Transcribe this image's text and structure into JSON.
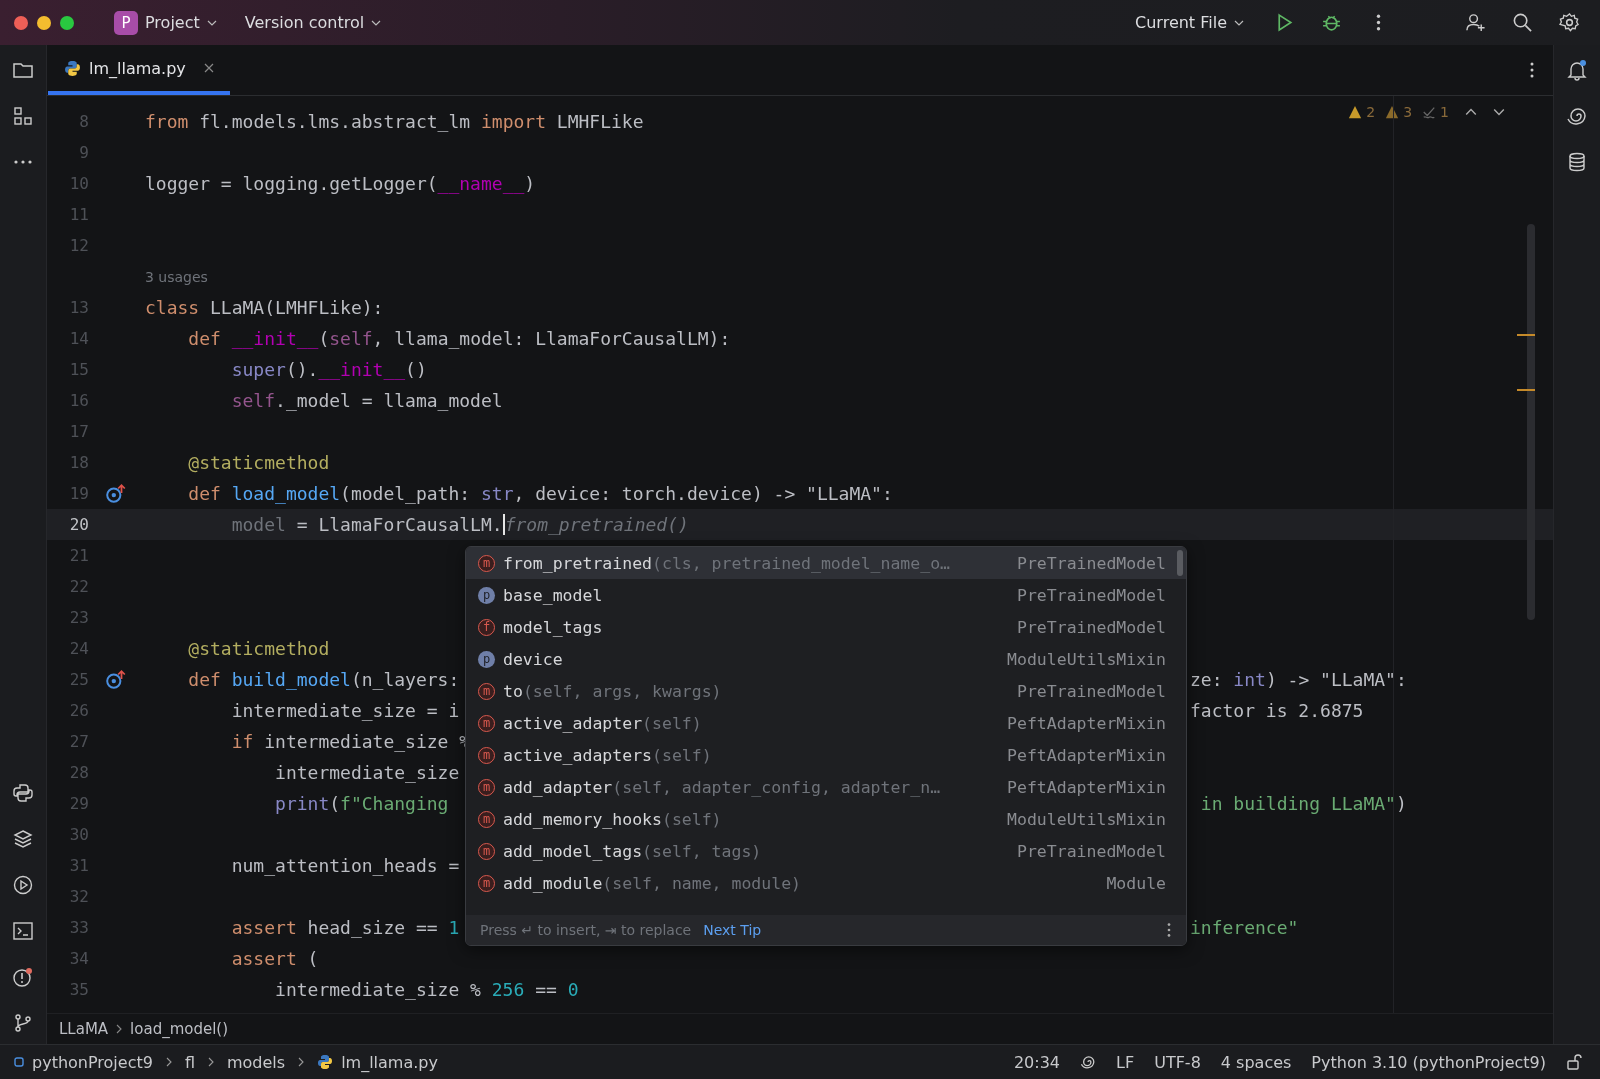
{
  "titlebar": {
    "project_badge": "P",
    "project": "Project",
    "vcs": "Version control",
    "run_config": "Current File"
  },
  "tab": {
    "label": "lm_llama.py",
    "selected": true
  },
  "inspections": {
    "warnings": "2",
    "weak_warnings": "3",
    "typos": "1"
  },
  "rows": [
    {
      "kind": "code",
      "number": "8",
      "tokens": [
        {
          "kind": "kw",
          "s": "from"
        },
        {
          "kind": "plain",
          "s": " fl.models.lms.abstract_lm "
        },
        {
          "kind": "kw",
          "s": "import"
        },
        {
          "kind": "plain",
          "s": " LMHFLike"
        }
      ]
    },
    {
      "kind": "code",
      "number": "9",
      "tokens": []
    },
    {
      "kind": "code",
      "number": "10",
      "tokens": [
        {
          "kind": "plain",
          "s": "logger = logging.getLogger("
        },
        {
          "kind": "dunder",
          "s": "__name__"
        },
        {
          "kind": "plain",
          "s": ")"
        }
      ]
    },
    {
      "kind": "code",
      "number": "11",
      "tokens": []
    },
    {
      "kind": "code",
      "number": "12",
      "tokens": []
    },
    {
      "kind": "usages",
      "text": "3 usages"
    },
    {
      "kind": "code",
      "number": "13",
      "tokens": [
        {
          "kind": "kw",
          "s": "class"
        },
        {
          "kind": "plain",
          "s": " LLaMA(LMHFLike):"
        }
      ]
    },
    {
      "kind": "code",
      "number": "14",
      "tokens": [
        {
          "kind": "kw",
          "s": "    def"
        },
        {
          "kind": "dunder",
          "s": " __init__"
        },
        {
          "kind": "plain",
          "s": "("
        },
        {
          "kind": "self",
          "s": "self"
        },
        {
          "kind": "plain",
          "s": ", llama_model: LlamaForCausalLM):"
        }
      ]
    },
    {
      "kind": "code",
      "number": "15",
      "tokens": [
        {
          "kind": "builtin",
          "s": "        super"
        },
        {
          "kind": "plain",
          "s": "()."
        },
        {
          "kind": "dunder",
          "s": "__init__"
        },
        {
          "kind": "plain",
          "s": "()"
        }
      ]
    },
    {
      "kind": "code",
      "number": "16",
      "tokens": [
        {
          "kind": "self",
          "s": "        self"
        },
        {
          "kind": "plain",
          "s": "._model = llama_model"
        }
      ]
    },
    {
      "kind": "code",
      "number": "17",
      "tokens": []
    },
    {
      "kind": "code",
      "number": "18",
      "tokens": [
        {
          "kind": "deco",
          "s": "    @staticmethod"
        }
      ]
    },
    {
      "kind": "code",
      "number": "19",
      "override": true,
      "tokens": [
        {
          "kind": "kw",
          "s": "    def"
        },
        {
          "kind": "fn",
          "s": " load_model"
        },
        {
          "kind": "plain",
          "s": "(model_path: "
        },
        {
          "kind": "builtin",
          "s": "str"
        },
        {
          "kind": "plain",
          "s": ", device: torch.device) -> \"LLaMA\":"
        }
      ]
    },
    {
      "kind": "code",
      "number": "20",
      "current": true,
      "tokens": [
        {
          "kind": "dim",
          "s": "        model"
        },
        {
          "kind": "plain",
          "s": " = LlamaForCausalLM."
        },
        {
          "kind": "hint",
          "s": "from_pretrained()"
        }
      ]
    },
    {
      "kind": "code",
      "number": "21",
      "tokens": []
    },
    {
      "kind": "code",
      "number": "22",
      "tokens": []
    },
    {
      "kind": "code",
      "number": "23",
      "tokens": []
    },
    {
      "kind": "code",
      "number": "24",
      "tokens": [
        {
          "kind": "deco",
          "s": "    @staticmethod"
        }
      ]
    },
    {
      "kind": "code",
      "number": "25",
      "override": true,
      "tokens": [
        {
          "kind": "kw",
          "s": "    def"
        },
        {
          "kind": "fn",
          "s": " build_model"
        },
        {
          "kind": "plain",
          "s": "(n_layers:"
        }
      ],
      "tail": [
        {
          "kind": "plain",
          "s": "ze: "
        },
        {
          "kind": "builtin",
          "s": "int"
        },
        {
          "kind": "plain",
          "s": ") -> \"LLaMA\":"
        }
      ]
    },
    {
      "kind": "code",
      "number": "26",
      "tokens": [
        {
          "kind": "plain",
          "s": "        intermediate_size = i"
        }
      ],
      "tail": [
        {
          "kind": "plain",
          "s": "factor is 2.6875"
        }
      ]
    },
    {
      "kind": "code",
      "number": "27",
      "tokens": [
        {
          "kind": "kw",
          "s": "        if"
        },
        {
          "kind": "plain",
          "s": " intermediate_size %"
        }
      ]
    },
    {
      "kind": "code",
      "number": "28",
      "tokens": [
        {
          "kind": "plain",
          "s": "            intermediate_size"
        }
      ]
    },
    {
      "kind": "code",
      "number": "29",
      "tokens": [
        {
          "kind": "builtin",
          "s": "            print"
        },
        {
          "kind": "plain",
          "s": "("
        },
        {
          "kind": "str",
          "s": "f\"Changing"
        }
      ],
      "tail": [
        {
          "kind": "str",
          "s": " in building LLaMA\""
        },
        {
          "kind": "plain",
          "s": ")"
        }
      ]
    },
    {
      "kind": "code",
      "number": "30",
      "tokens": []
    },
    {
      "kind": "code",
      "number": "31",
      "tokens": [
        {
          "kind": "plain",
          "s": "        num_attention_heads ="
        }
      ]
    },
    {
      "kind": "code",
      "number": "32",
      "tokens": []
    },
    {
      "kind": "code",
      "number": "33",
      "tokens": [
        {
          "kind": "kw",
          "s": "        assert"
        },
        {
          "kind": "plain",
          "s": " head_size == "
        },
        {
          "kind": "num",
          "s": "1"
        }
      ],
      "tail": [
        {
          "kind": "str",
          "s": "inference\""
        }
      ]
    },
    {
      "kind": "code",
      "number": "34",
      "tokens": [
        {
          "kind": "kw",
          "s": "        assert"
        },
        {
          "kind": "plain",
          "s": " ("
        }
      ]
    },
    {
      "kind": "code",
      "number": "35",
      "tokens": [
        {
          "kind": "plain",
          "s": "            intermediate_size % "
        },
        {
          "kind": "num",
          "s": "256"
        },
        {
          "kind": "plain",
          "s": " == "
        },
        {
          "kind": "num",
          "s": "0"
        }
      ]
    }
  ],
  "completion": {
    "items": [
      {
        "kind": "method",
        "letter": "m",
        "name": "from_pretrained",
        "params": "(cls, pretrained_model_name_o…",
        "type": "PreTrainedModel",
        "selected": true
      },
      {
        "kind": "property",
        "letter": "p",
        "name": "base_model",
        "type": "PreTrainedModel",
        "selected": false
      },
      {
        "kind": "field",
        "letter": "f",
        "name": "model_tags",
        "type": "PreTrainedModel",
        "selected": false
      },
      {
        "kind": "property",
        "letter": "p",
        "name": "device",
        "type": "ModuleUtilsMixin",
        "selected": false
      },
      {
        "kind": "method",
        "letter": "m",
        "name": "to",
        "params": "(self, args, kwargs)",
        "type": "PreTrainedModel",
        "selected": false
      },
      {
        "kind": "method",
        "letter": "m",
        "name": "active_adapter",
        "params": "(self)",
        "type": "PeftAdapterMixin",
        "selected": false
      },
      {
        "kind": "method",
        "letter": "m",
        "name": "active_adapters",
        "params": "(self)",
        "type": "PeftAdapterMixin",
        "selected": false
      },
      {
        "kind": "method",
        "letter": "m",
        "name": "add_adapter",
        "params": "(self, adapter_config, adapter_n…",
        "type": "PeftAdapterMixin",
        "selected": false
      },
      {
        "kind": "method",
        "letter": "m",
        "name": "add_memory_hooks",
        "params": "(self)",
        "type": "ModuleUtilsMixin",
        "selected": false
      },
      {
        "kind": "method",
        "letter": "m",
        "name": "add_model_tags",
        "params": "(self, tags)",
        "type": "PreTrainedModel",
        "selected": false
      },
      {
        "kind": "method",
        "letter": "m",
        "name": "add_module",
        "params": "(self, name, module)",
        "type": "Module",
        "selected": false
      }
    ],
    "footer": "Press ↵ to insert, ⇥ to replace",
    "tip_link": "Next Tip"
  },
  "breadcrumbs": [
    "LLaMA",
    "load_model()"
  ],
  "status_bar": {
    "path": [
      "pythonProject9",
      "fl",
      "models",
      "lm_llama.py"
    ],
    "position": "20:34",
    "line_separator": "LF",
    "encoding": "UTF-8",
    "indent": "4 spaces",
    "interpreter": "Python 3.10 (pythonProject9)"
  }
}
